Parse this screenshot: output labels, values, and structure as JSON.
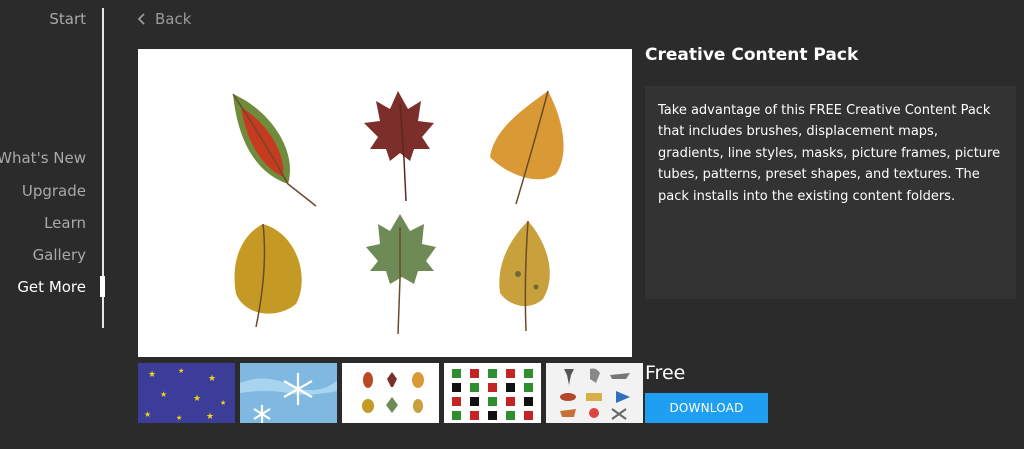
{
  "sidebar": {
    "items": [
      {
        "label": "Start"
      },
      {
        "label": "What's New"
      },
      {
        "label": "Upgrade"
      },
      {
        "label": "Learn"
      },
      {
        "label": "Gallery"
      },
      {
        "label": "Get More"
      }
    ],
    "active": "Get More"
  },
  "header": {
    "back_label": "Back"
  },
  "product": {
    "title": "Creative Content Pack",
    "description": "Take advantage of this FREE Creative Content Pack that includes brushes, displacement maps, gradients, line styles, masks, picture frames, picture tubes, patterns, preset shapes, and textures. The pack installs into the existing content folders.",
    "price": "Free",
    "download_label": "DOWNLOAD"
  },
  "colors": {
    "background": "#2b2b2b",
    "panel": "#333333",
    "accent": "#1e9ff2",
    "text": "#ffffff",
    "muted": "#a9a9a9"
  },
  "icons": {
    "back": "chevron-left-icon"
  }
}
